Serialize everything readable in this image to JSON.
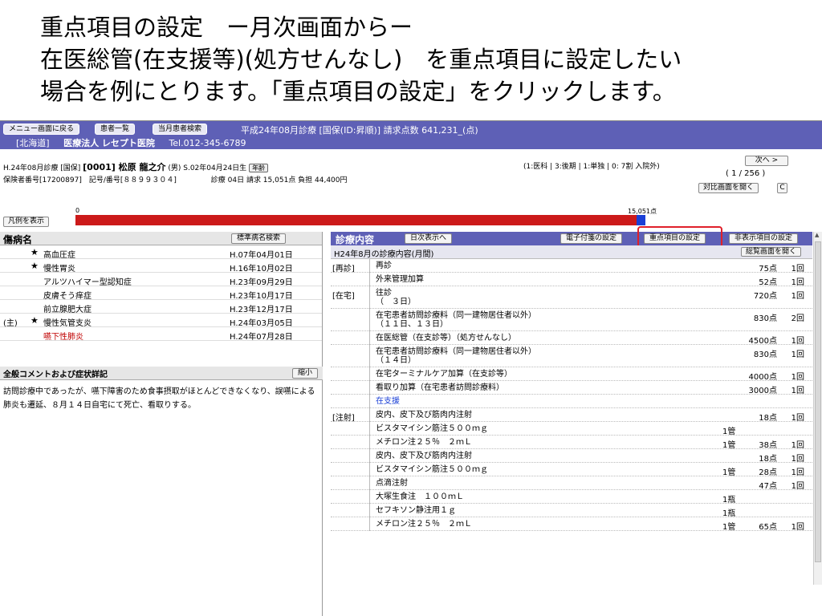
{
  "caption": {
    "line1": "重点項目の設定　ー月次画面からー",
    "line2": "在医総管(在支援等)(処方せんなし)　を重点項目に設定したい",
    "line3": "場合を例にとります。「重点項目の設定」をクリックします。"
  },
  "topbar": {
    "btn_menu": "メニュー画面に戻る",
    "btn_patients": "患者一覧",
    "btn_current": "当月患者検索",
    "period": "平成24年08月診療 [国保(ID:昇順)] 請求点数 641,231_(点)",
    "region": "[北海道]",
    "clinic": "医療法人 レセプト医院",
    "tel": "Tel.012-345-6789"
  },
  "patient": {
    "row1_prefix": "H.24年08月診療 [国保]",
    "id_name": "[0001] 松原 龍之介",
    "dob": "(男) S.02年04月24日生",
    "age_tag": "年齢",
    "row2_prefix": "保険者番号[17200897]　記号/番号[８８９９３０４]",
    "row2_rest": "診療 04日 請求 15,051点 負担 44,400円",
    "legend": "(1:医科 | 3:後期 | 1:単独 | 0: 7割 入院外)",
    "next_btn": "次へ >",
    "pager": "( 1 / 256 )",
    "compare_btn": "対比画面を開く",
    "c_btn": "C",
    "legend_btn": "凡例を表示",
    "bar_zero": "0",
    "bar_max": "15,051点",
    "bar_fraction": 0.985
  },
  "diseases": {
    "title": "傷病名",
    "search_btn": "標準病名検索",
    "rows": [
      {
        "prefix": "",
        "star": "★",
        "name": "高血圧症",
        "date": "H.07年04月01日",
        "red": false
      },
      {
        "prefix": "",
        "star": "★",
        "name": "慢性胃炎",
        "date": "H.16年10月02日",
        "red": false
      },
      {
        "prefix": "",
        "star": "",
        "name": "アルツハイマー型認知症",
        "date": "H.23年09月29日",
        "red": false
      },
      {
        "prefix": "",
        "star": "",
        "name": "皮膚そう痒症",
        "date": "H.23年10月17日",
        "red": false
      },
      {
        "prefix": "",
        "star": "",
        "name": "前立腺肥大症",
        "date": "H.23年12月17日",
        "red": false
      },
      {
        "prefix": "(主)",
        "star": "★",
        "name": "慢性気管支炎",
        "date": "H.24年03月05日",
        "red": false
      },
      {
        "prefix": "",
        "star": "",
        "name": "嚥下性肺炎",
        "date": "H.24年07月28日",
        "red": true
      }
    ]
  },
  "comment": {
    "title": "全般コメントおよび症状詳記",
    "shrink_btn": "縮小",
    "text": "訪問診療中であったが、嚥下障害のため食事摂取がほとんどできなくなり、誤嚥による肺炎も遷延、８月１４日自宅にて死亡、看取りする。"
  },
  "treatment": {
    "title": "診療内容",
    "daily_btn": "日次表示へ",
    "attach_btn": "電子付箋の設定",
    "priority_btn": "重点項目の設定",
    "hidden_btn": "非表示項目の設定",
    "subhead": "H24年8月の診療内容(月間)",
    "summary_btn": "総覧画面を開く",
    "items": [
      {
        "cat": "[再診]",
        "name": "再診",
        "qty": "",
        "pts": "75点",
        "cnt": "1回",
        "h": 17,
        "blue": false
      },
      {
        "cat": "",
        "name": "外来管理加算",
        "qty": "",
        "pts": "52点",
        "cnt": "1回",
        "h": 17,
        "blue": false
      },
      {
        "cat": "[在宅]",
        "name": "往診\n（　３日）",
        "qty": "",
        "pts": "720点",
        "cnt": "1回",
        "h": 28,
        "blue": false
      },
      {
        "cat": "",
        "name": "在宅患者訪問診療料（同一建物居住者以外）\n（１１日、１３日）",
        "qty": "",
        "pts": "830点",
        "cnt": "2回",
        "h": 28,
        "blue": false
      },
      {
        "cat": "",
        "name": "在医総管（在支診等）（処方せんなし）",
        "qty": "",
        "pts": "4500点",
        "cnt": "1回",
        "h": 17,
        "blue": false
      },
      {
        "cat": "",
        "name": "在宅患者訪問診療料（同一建物居住者以外）\n（１４日）",
        "qty": "",
        "pts": "830点",
        "cnt": "1回",
        "h": 28,
        "blue": false
      },
      {
        "cat": "",
        "name": "在宅ターミナルケア加算（在支診等）",
        "qty": "",
        "pts": "4000点",
        "cnt": "1回",
        "h": 17,
        "blue": false
      },
      {
        "cat": "",
        "name": "看取り加算（在宅患者訪問診療料）",
        "qty": "",
        "pts": "3000点",
        "cnt": "1回",
        "h": 17,
        "blue": false
      },
      {
        "cat": "",
        "name": "在支援",
        "qty": "",
        "pts": "",
        "cnt": "",
        "h": 17,
        "blue": true
      },
      {
        "cat": "[注射]",
        "name": "皮内、皮下及び筋肉内注射",
        "qty": "",
        "pts": "18点",
        "cnt": "1回",
        "h": 17,
        "blue": false
      },
      {
        "cat": "",
        "name": "ビスタマイシン筋注５００ｍｇ",
        "qty": "1管",
        "pts": "",
        "cnt": "",
        "h": 17,
        "blue": false
      },
      {
        "cat": "",
        "name": "メチロン注２５％　２ｍＬ",
        "qty": "1管",
        "pts": "38点",
        "cnt": "1回",
        "h": 17,
        "blue": false
      },
      {
        "cat": "",
        "name": "皮内、皮下及び筋肉内注射",
        "qty": "",
        "pts": "18点",
        "cnt": "1回",
        "h": 17,
        "blue": false
      },
      {
        "cat": "",
        "name": "ビスタマイシン筋注５００ｍｇ",
        "qty": "1管",
        "pts": "28点",
        "cnt": "1回",
        "h": 17,
        "blue": false
      },
      {
        "cat": "",
        "name": "点滴注射",
        "qty": "",
        "pts": "47点",
        "cnt": "1回",
        "h": 17,
        "blue": false
      },
      {
        "cat": "",
        "name": "大塚生食注　１００ｍＬ",
        "qty": "1瓶",
        "pts": "",
        "cnt": "",
        "h": 17,
        "blue": false
      },
      {
        "cat": "",
        "name": "セフキソン静注用１ｇ",
        "qty": "1瓶",
        "pts": "",
        "cnt": "",
        "h": 17,
        "blue": false
      },
      {
        "cat": "",
        "name": "メチロン注２５％　２ｍＬ",
        "qty": "1管",
        "pts": "65点",
        "cnt": "1回",
        "h": 17,
        "blue": false
      }
    ]
  }
}
